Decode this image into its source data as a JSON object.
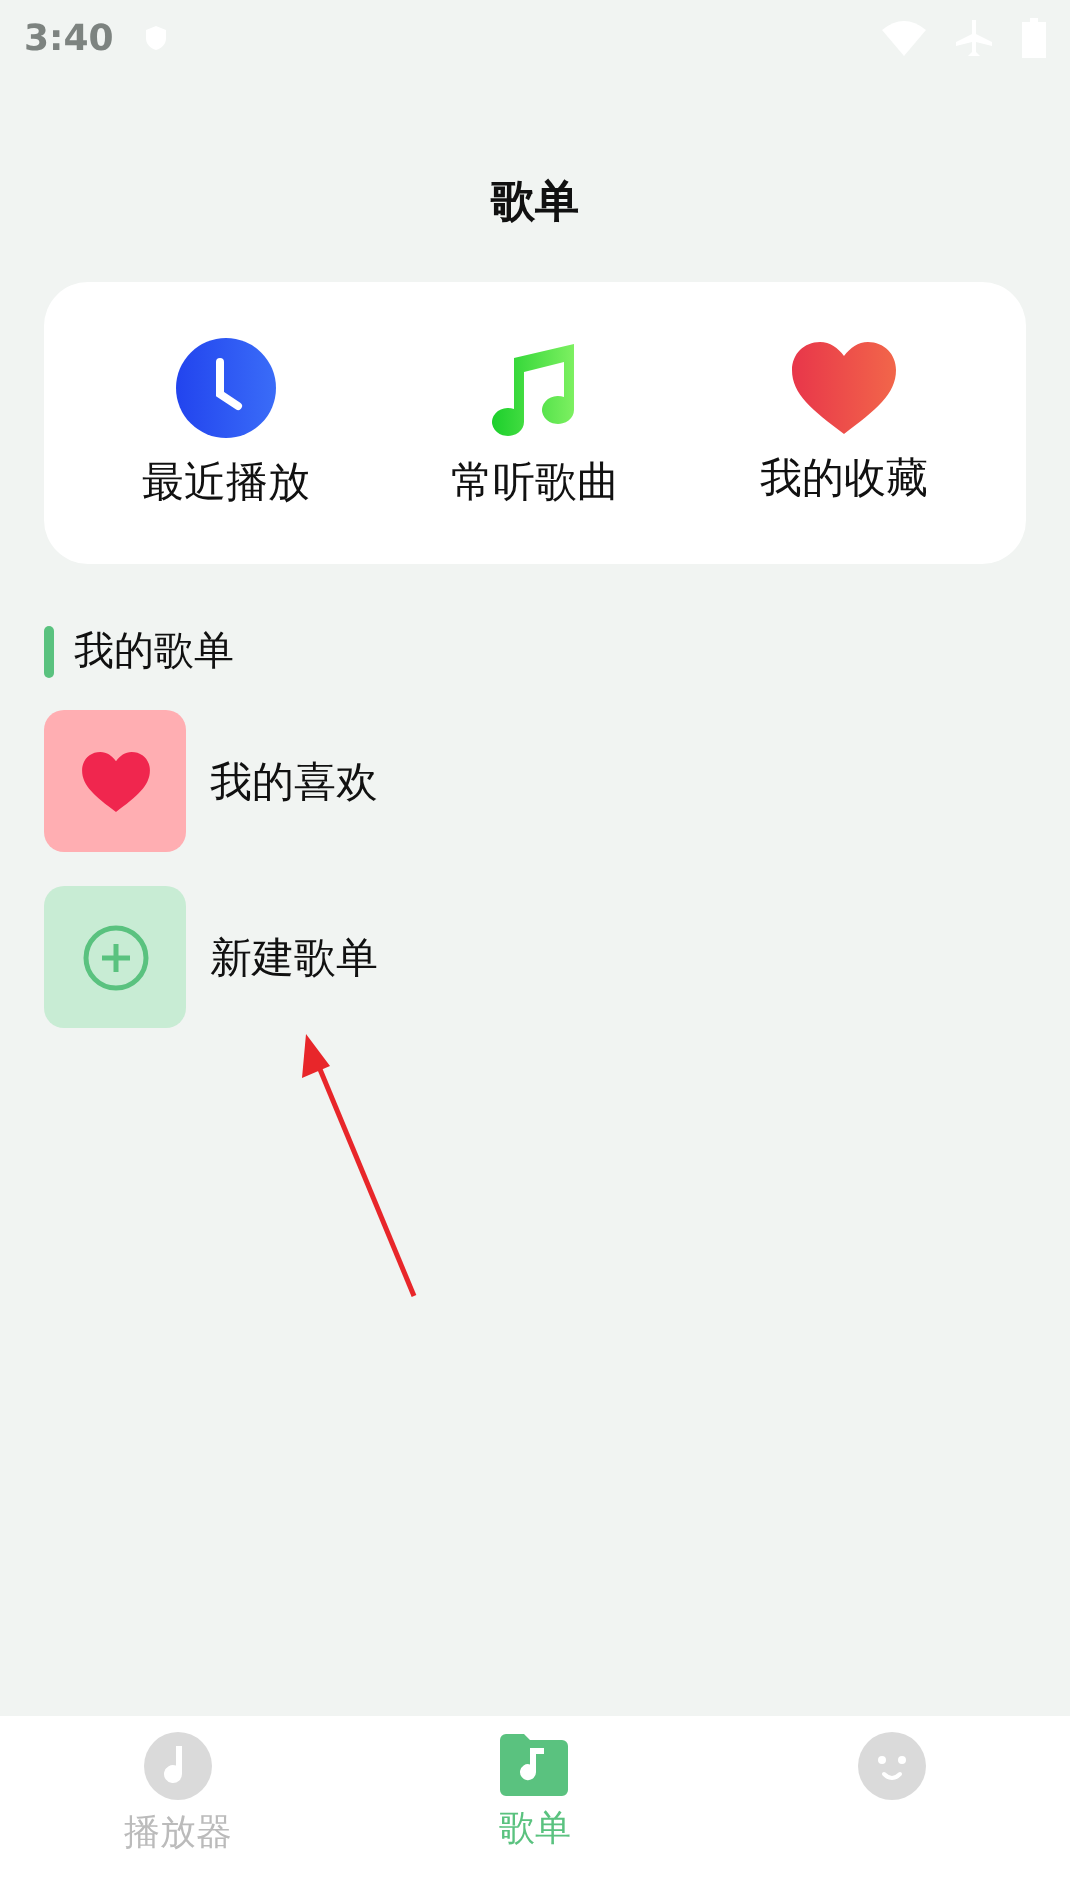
{
  "status_bar": {
    "time": "3:40"
  },
  "title": "歌单",
  "shortcuts": [
    {
      "kind": "clock",
      "label": "最近播放"
    },
    {
      "kind": "note",
      "label": "常听歌曲"
    },
    {
      "kind": "heart",
      "label": "我的收藏"
    }
  ],
  "section": {
    "title": "我的歌单"
  },
  "playlists": [
    {
      "kind": "liked",
      "name": "我的喜欢"
    },
    {
      "kind": "create",
      "name": "新建歌单"
    }
  ],
  "annotation": {
    "kind": "arrow"
  },
  "tabs": [
    {
      "kind": "player",
      "label": "播放器",
      "selected": false
    },
    {
      "kind": "playlist",
      "label": "歌单",
      "selected": true
    },
    {
      "kind": "profile",
      "selected": false
    }
  ]
}
